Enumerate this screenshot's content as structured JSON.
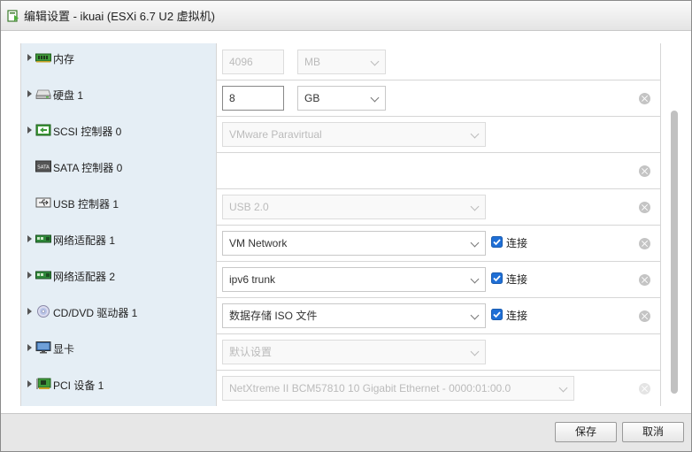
{
  "window": {
    "title": "编辑设置 - ikuai (ESXi 6.7 U2 虚拟机)"
  },
  "rows": [
    {
      "label": "内存",
      "icon": "memory-icon",
      "value": "4096",
      "unit": "MB"
    },
    {
      "label": "硬盘 1",
      "icon": "hard-disk-icon",
      "value": "8",
      "unit": "GB"
    },
    {
      "label": "SCSI 控制器 0",
      "icon": "scsi-controller-icon",
      "value": "VMware Paravirtual"
    },
    {
      "label": "SATA 控制器 0",
      "icon": "sata-controller-icon",
      "icon_text": "SATA"
    },
    {
      "label": "USB 控制器 1",
      "icon": "usb-icon",
      "value": "USB 2.0"
    },
    {
      "label": "网络适配器 1",
      "icon": "network-adapter-icon",
      "value": "VM Network",
      "connect_label": "连接",
      "connected": true
    },
    {
      "label": "网络适配器 2",
      "icon": "network-adapter-icon",
      "value": "ipv6 trunk",
      "connect_label": "连接",
      "connected": true
    },
    {
      "label": "CD/DVD 驱动器 1",
      "icon": "cd-dvd-icon",
      "value": "数据存储 ISO 文件",
      "connect_label": "连接",
      "connected": true
    },
    {
      "label": "显卡",
      "icon": "monitor-icon",
      "value": "默认设置"
    },
    {
      "label": "PCI 设备 1",
      "icon": "pci-device-icon",
      "value": "NetXtreme II BCM57810 10 Gigabit Ethernet - 0000:01:00.0"
    }
  ],
  "footer": {
    "save_label": "保存",
    "cancel_label": "取消"
  },
  "colors": {
    "label_column_bg": "#e5eef5",
    "checkbox_blue": "#1f6fd6",
    "footer_bg": "#e7e7e7"
  }
}
